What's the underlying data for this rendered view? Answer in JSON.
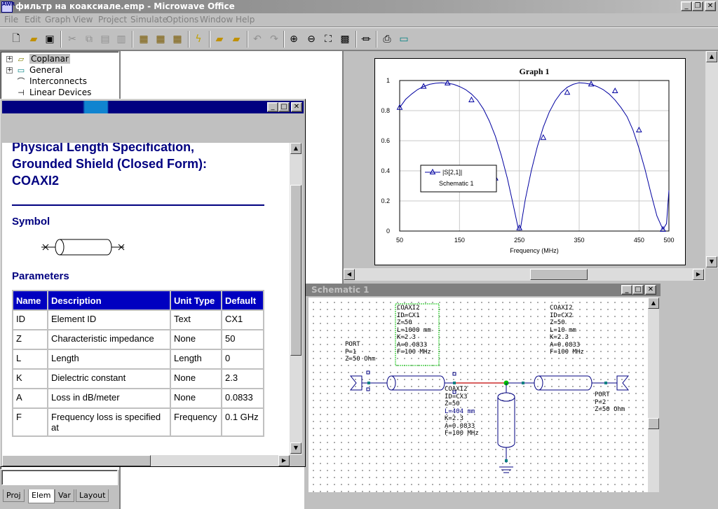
{
  "window": {
    "title": "фильтр на коаксиале.emp - Microwave Office",
    "icon_label": "AWR"
  },
  "menu": [
    "File",
    "Edit",
    "Graph",
    "View",
    "Project",
    "Simulate",
    "Options",
    "Window",
    "Help"
  ],
  "toolbar_icons": [
    "new-file-icon",
    "open-folder-icon",
    "save-icon",
    "cut-icon",
    "copy-icon",
    "paste-icon",
    "import-icon",
    "export-icon",
    "add-icon",
    "lightning-icon",
    "folder-up-icon",
    "folder-down-icon",
    "undo-icon",
    "redo-icon",
    "zoom-in-icon",
    "zoom-out-icon",
    "zoom-fit-icon",
    "zoom-area-icon",
    "component-icon",
    "print-icon",
    "layout-icon"
  ],
  "tree": {
    "items": [
      {
        "label": "Coplanar",
        "expand": "+",
        "icon": "coplanar-icon",
        "selected": true
      },
      {
        "label": "General",
        "expand": "+",
        "icon": "general-icon"
      },
      {
        "label": "Interconnects",
        "expand": "",
        "icon": "interconnect-icon"
      },
      {
        "label": "Linear Devices",
        "expand": "",
        "icon": "linear-device-icon"
      }
    ]
  },
  "tabs": [
    "Proj",
    "Elem",
    "Var",
    "Layout"
  ],
  "help": {
    "heading": [
      "Physical Length Specification,",
      "Grounded Shield (Closed Form):",
      "COAXI2"
    ],
    "symbol_title": "Symbol",
    "params_title": "Parameters",
    "table_headers": [
      "Name",
      "Description",
      "Unit Type",
      "Default"
    ],
    "rows": [
      [
        "ID",
        "Element ID",
        "Text",
        "CX1"
      ],
      [
        "Z",
        "Characteristic impedance",
        "None",
        "50"
      ],
      [
        "L",
        "Length",
        "Length",
        "0"
      ],
      [
        "K",
        "Dielectric constant",
        "None",
        "2.3"
      ],
      [
        "A",
        "Loss in dB/meter",
        "None",
        "0.0833"
      ],
      [
        "F",
        "Frequency loss is specified at",
        "Frequency",
        "0.1 GHz"
      ]
    ]
  },
  "schematic": {
    "title": "Schematic 1",
    "port1": [
      "PORT",
      "P=1",
      "Z=50 Ohm"
    ],
    "cx1": [
      "COAXI2",
      "ID=CX1",
      "Z=50",
      "L=1000 mm",
      "K=2.3",
      "A=0.0833",
      "F=100 MHz"
    ],
    "cx2": [
      "COAXI2",
      "ID=CX2",
      "Z=50",
      "L=10 mm",
      "K=2.3",
      "A=0.0833",
      "F=100 MHz"
    ],
    "cx3": [
      "COAXI2",
      "ID=CX3",
      "Z=50",
      "L=404 mm",
      "K=2.3",
      "A=0.0833",
      "F=100 MHz"
    ],
    "port2": [
      "PORT",
      "P=2",
      "Z=50 Ohm"
    ]
  },
  "chart_data": {
    "type": "line",
    "title": "Graph 1",
    "xlabel": "Frequency (MHz)",
    "ylabel": "",
    "xlim": [
      50,
      500
    ],
    "ylim": [
      0,
      1
    ],
    "xticks": [
      50,
      150,
      250,
      350,
      450,
      500
    ],
    "yticks": [
      0,
      0.2,
      0.4,
      0.6,
      0.8,
      1
    ],
    "grid": true,
    "legend": {
      "position": "bottom-left",
      "entries": [
        "|S[2,1]|",
        "Schematic 1"
      ]
    },
    "series": [
      {
        "name": "|S[2,1]|",
        "color": "#0000a0",
        "x": [
          50,
          60,
          70,
          80,
          90,
          100,
          110,
          120,
          130,
          140,
          150,
          160,
          170,
          180,
          190,
          200,
          210,
          220,
          230,
          240,
          248,
          252,
          260,
          270,
          280,
          290,
          300,
          310,
          320,
          330,
          340,
          350,
          360,
          370,
          380,
          390,
          400,
          410,
          420,
          430,
          440,
          450,
          460,
          470,
          480,
          490,
          496,
          500
        ],
        "y": [
          0.82,
          0.875,
          0.91,
          0.94,
          0.96,
          0.975,
          0.982,
          0.985,
          0.982,
          0.975,
          0.96,
          0.94,
          0.91,
          0.87,
          0.81,
          0.73,
          0.63,
          0.5,
          0.35,
          0.17,
          0.02,
          0.02,
          0.21,
          0.4,
          0.56,
          0.69,
          0.79,
          0.865,
          0.92,
          0.955,
          0.975,
          0.985,
          0.982,
          0.975,
          0.96,
          0.94,
          0.91,
          0.87,
          0.82,
          0.76,
          0.67,
          0.55,
          0.41,
          0.25,
          0.1,
          0.01,
          0.05,
          0.27
        ],
        "markers_x": [
          50,
          90,
          130,
          170,
          210,
          250,
          290,
          330,
          370,
          410,
          450,
          490
        ],
        "markers_y": [
          0.82,
          0.96,
          0.982,
          0.87,
          0.35,
          0.02,
          0.62,
          0.92,
          0.975,
          0.93,
          0.67,
          0.01
        ]
      }
    ]
  }
}
